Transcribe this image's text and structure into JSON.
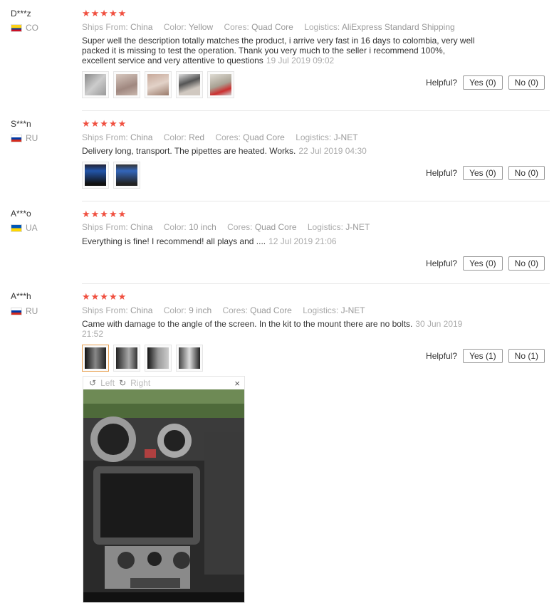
{
  "reviews": [
    {
      "user": "D***z",
      "country": "CO",
      "stars": "★★★★★",
      "meta": [
        {
          "k": "Ships From:",
          "v": "China"
        },
        {
          "k": "Color:",
          "v": "Yellow"
        },
        {
          "k": "Cores:",
          "v": "Quad Core"
        },
        {
          "k": "Logistics:",
          "v": "AliExpress Standard Shipping"
        }
      ],
      "text": "Super well the description totally matches the product, i arrive very fast in 16 days to colombia, very well packed it is missing to test the operation. Thank you very much to the seller i recommend 100%, excellent service and very attentive to questions",
      "date": "19 Jul 2019 09:02",
      "helpful": "Helpful?",
      "yes": "Yes (0)",
      "no": "No (0)"
    },
    {
      "user": "S***n",
      "country": "RU",
      "stars": "★★★★★",
      "meta": [
        {
          "k": "Ships From:",
          "v": "China"
        },
        {
          "k": "Color:",
          "v": "Red"
        },
        {
          "k": "Cores:",
          "v": "Quad Core"
        },
        {
          "k": "Logistics:",
          "v": "J-NET"
        }
      ],
      "text": "Delivery long, transport. The pipettes are heated. Works.",
      "date": "22 Jul 2019 04:30",
      "helpful": "Helpful?",
      "yes": "Yes (0)",
      "no": "No (0)"
    },
    {
      "user": "A***o",
      "country": "UA",
      "stars": "★★★★★",
      "meta": [
        {
          "k": "Ships From:",
          "v": "China"
        },
        {
          "k": "Color:",
          "v": "10 inch"
        },
        {
          "k": "Cores:",
          "v": "Quad Core"
        },
        {
          "k": "Logistics:",
          "v": "J-NET"
        }
      ],
      "text": "Everything is fine! I recommend! all plays and ....",
      "date": "12 Jul 2019 21:06",
      "helpful": "Helpful?",
      "yes": "Yes (0)",
      "no": "No (0)"
    },
    {
      "user": "A***h",
      "country": "RU",
      "stars": "★★★★★",
      "meta": [
        {
          "k": "Ships From:",
          "v": "China"
        },
        {
          "k": "Color:",
          "v": "9 inch"
        },
        {
          "k": "Cores:",
          "v": "Quad Core"
        },
        {
          "k": "Logistics:",
          "v": "J-NET"
        }
      ],
      "text": "Came with damage to the angle of the screen. In the kit to the mount there are no bolts.",
      "date": "30 Jun 2019 21:52",
      "helpful": "Helpful?",
      "yes": "Yes (1)",
      "no": "No (1)"
    }
  ],
  "viewer": {
    "left": "Left",
    "right": "Right",
    "close": "×"
  },
  "flags": {
    "CO": [
      "#fcd116",
      "#003893",
      "#ce1126"
    ],
    "RU": [
      "#ffffff",
      "#0039a6",
      "#d52b1e"
    ],
    "UA": [
      "#0057b7",
      "#ffd700"
    ]
  }
}
